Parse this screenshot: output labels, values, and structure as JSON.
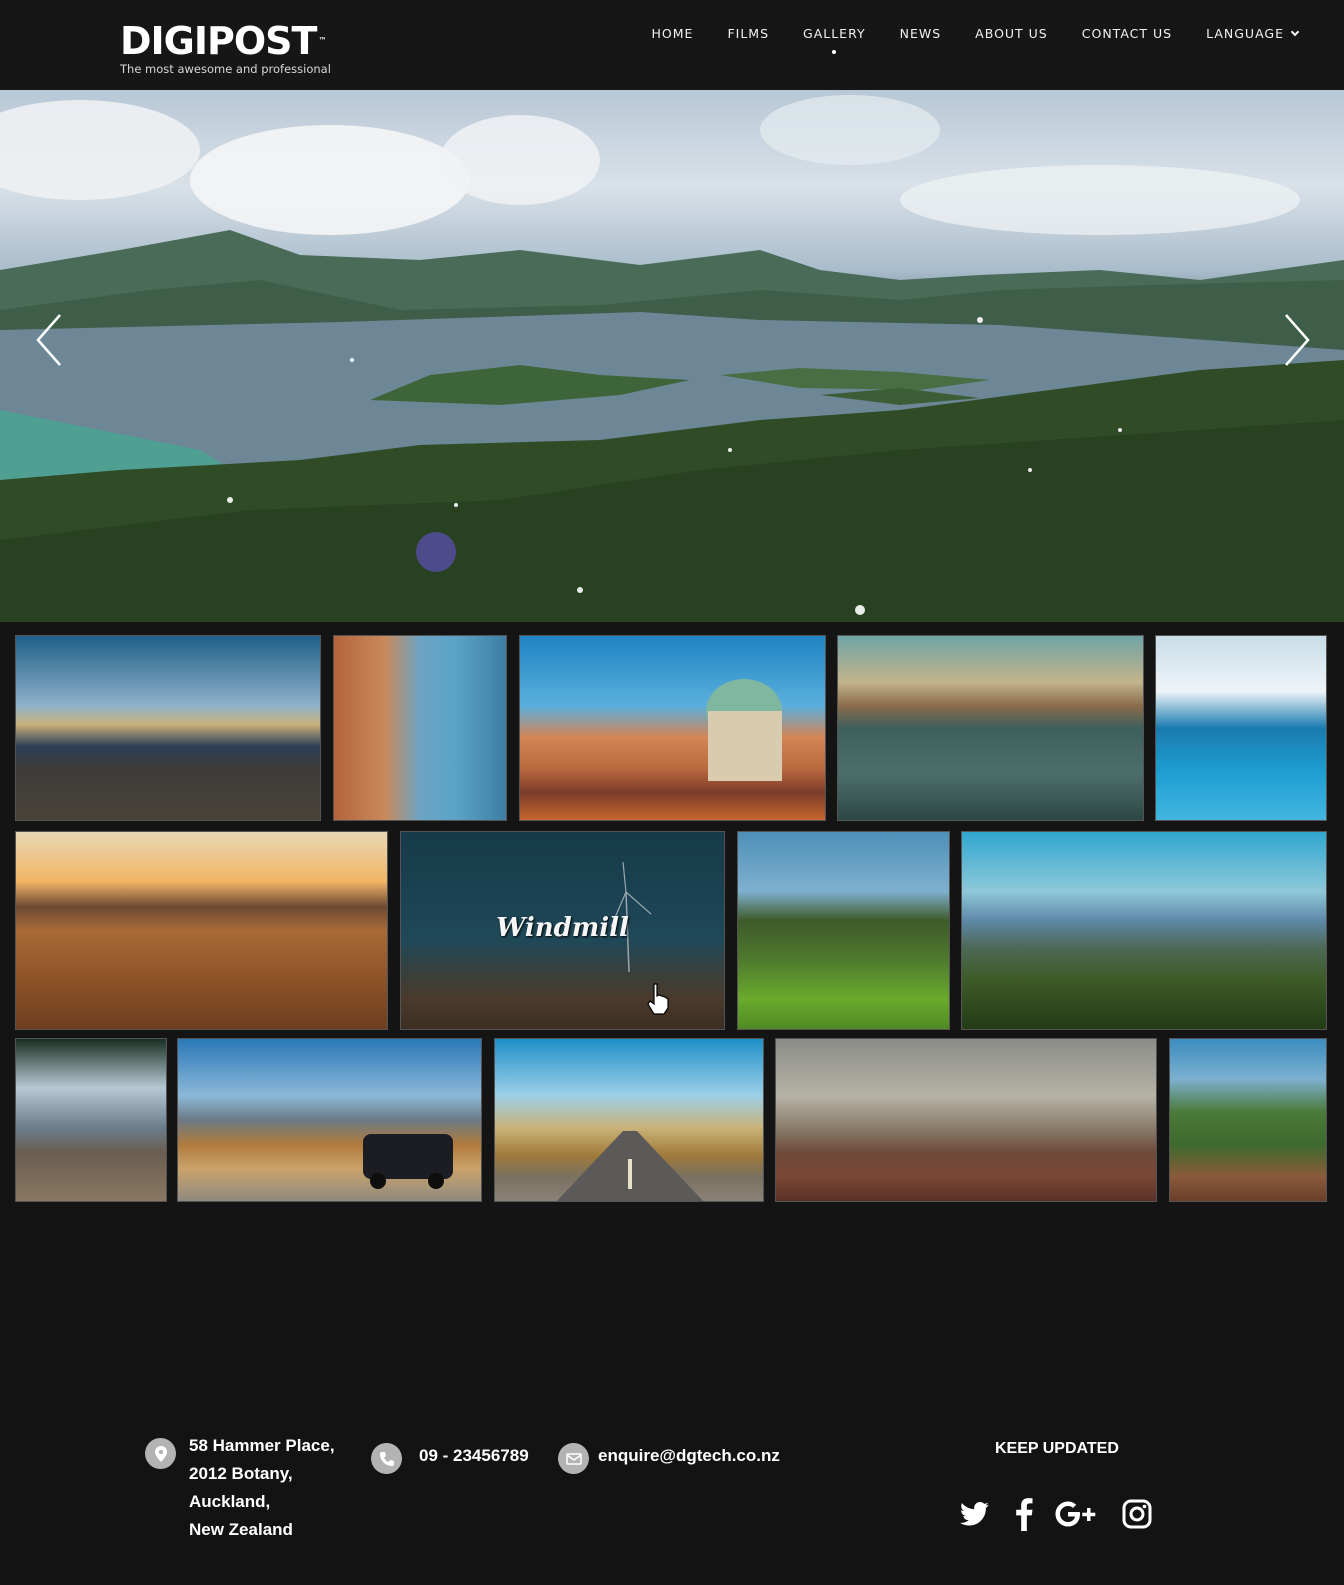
{
  "header": {
    "logo": "DIGIPOST",
    "logo_tm": "™",
    "tagline": "The most awesome and professional",
    "nav": [
      {
        "label": "HOME"
      },
      {
        "label": "FILMS"
      },
      {
        "label": "GALLERY",
        "active": true
      },
      {
        "label": "NEWS"
      },
      {
        "label": "ABOUT US"
      },
      {
        "label": "CONTACT US"
      },
      {
        "label": "LANGUAGE",
        "dropdown": true
      }
    ]
  },
  "hero": {
    "left_icon": "chevron-left-icon",
    "right_icon": "chevron-right-icon"
  },
  "gallery": {
    "windmill_caption": "Windmill"
  },
  "footer": {
    "address_lines": [
      "58 Hammer Place,",
      "2012 Botany,",
      "Auckland,",
      "New Zealand"
    ],
    "phone": "09 - 23456789",
    "email": "enquire@dgtech.co.nz",
    "keep_updated": "KEEP UPDATED",
    "social": [
      "twitter-icon",
      "facebook-icon",
      "google-plus-icon",
      "instagram-icon"
    ]
  },
  "colors": {
    "background": "#141414",
    "header": "#161616",
    "icon_circle": "#b3b3b3"
  }
}
